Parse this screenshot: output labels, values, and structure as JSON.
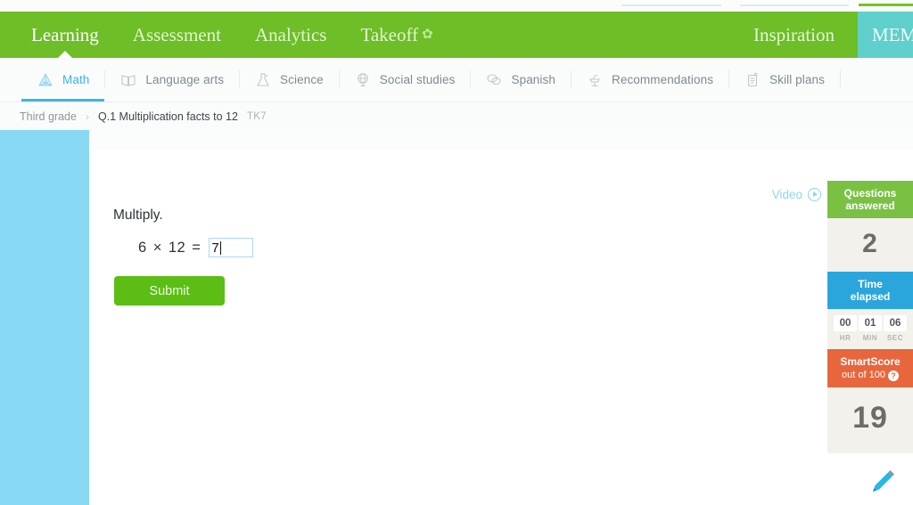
{
  "mainnav": {
    "items": [
      {
        "label": "Learning",
        "active": true
      },
      {
        "label": "Assessment",
        "active": false
      },
      {
        "label": "Analytics",
        "active": false
      },
      {
        "label": "Takeoff",
        "active": false
      }
    ],
    "takeoff_glyph": "✿",
    "inspiration_label": "Inspiration",
    "membership_label": "MEMBERSHIP",
    "bg_color": "#6dbe27",
    "membership_color": "#5fd0cb"
  },
  "subjects": [
    {
      "label": "Math",
      "icon": "pyramid-icon",
      "active": true
    },
    {
      "label": "Language arts",
      "icon": "book-icon",
      "active": false
    },
    {
      "label": "Science",
      "icon": "flask-icon",
      "active": false
    },
    {
      "label": "Social studies",
      "icon": "globe-icon",
      "active": false
    },
    {
      "label": "Spanish",
      "icon": "speech-bubbles-icon",
      "active": false
    },
    {
      "label": "Recommendations",
      "icon": "podium-icon",
      "active": false
    },
    {
      "label": "Skill plans",
      "icon": "clipboard-icon",
      "active": false
    }
  ],
  "breadcrumb": {
    "grade": "Third grade",
    "separator": "›",
    "skill": "Q.1 Multiplication facts to 12",
    "code": "TK7"
  },
  "question": {
    "prompt": "Multiply.",
    "operand_left": "6",
    "operator": "×",
    "operand_right": "12",
    "equals": "=",
    "answer_value": "7",
    "answer_placeholder": "",
    "submit_label": "Submit"
  },
  "video": {
    "label": "Video",
    "icon": "play-circle-icon"
  },
  "scorepanel": {
    "questions_answered": {
      "title_line1": "Questions",
      "title_line2": "answered",
      "value": "2",
      "color": "#7ac143"
    },
    "time_elapsed": {
      "title_line1": "Time",
      "title_line2": "elapsed",
      "color": "#2ba6dd",
      "hours": "00",
      "minutes": "01",
      "seconds": "06",
      "hours_label": "HR",
      "minutes_label": "MIN",
      "seconds_label": "SEC"
    },
    "smartscore": {
      "title": "SmartScore",
      "subtitle": "out of 100",
      "help_glyph": "?",
      "value": "19",
      "color": "#e8663c"
    }
  },
  "tools": {
    "pencil_label": "scratchpad"
  }
}
